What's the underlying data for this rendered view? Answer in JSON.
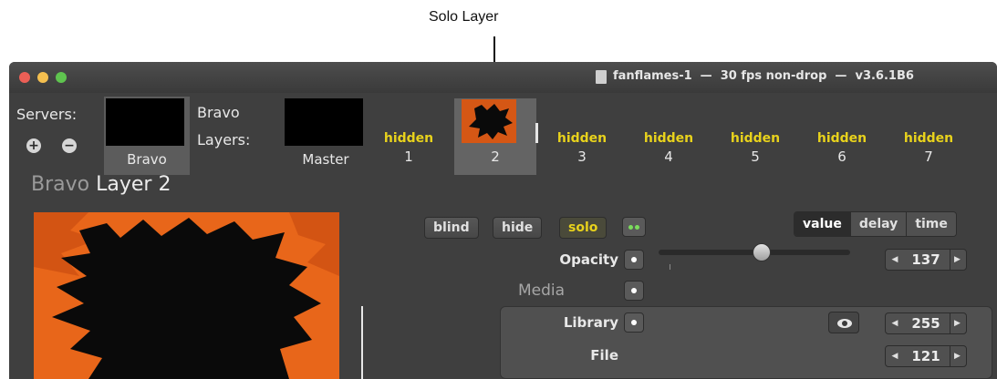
{
  "callout": {
    "label": "Solo Layer"
  },
  "window": {
    "title": "fanflames-1  —  30 fps non-drop  —  v3.6.1B6"
  },
  "servers": {
    "label": "Servers:",
    "add_icon": "plus-circle-icon",
    "remove_icon": "minus-circle-icon",
    "selected": "Bravo"
  },
  "layers_header": {
    "server_name": "Bravo",
    "label": "Layers:",
    "master": "Master"
  },
  "layers": [
    {
      "status": "hidden",
      "number": "1"
    },
    {
      "status": "",
      "number": "2"
    },
    {
      "status": "hidden",
      "number": "3"
    },
    {
      "status": "hidden",
      "number": "4"
    },
    {
      "status": "hidden",
      "number": "5"
    },
    {
      "status": "hidden",
      "number": "6"
    },
    {
      "status": "hidden",
      "number": "7"
    }
  ],
  "panel": {
    "server": "Bravo",
    "layer": "Layer 2"
  },
  "controls": {
    "blind": "blind",
    "hide": "hide",
    "solo": "solo"
  },
  "segments": [
    "value",
    "delay",
    "time"
  ],
  "opacity": {
    "label": "Opacity",
    "value": "137",
    "level": 0.54
  },
  "media": {
    "label": "Media",
    "library_label": "Library",
    "library_value": "255",
    "file_label": "File",
    "file_value": "121"
  },
  "colors": {
    "accent_yellow": "#e8d21c",
    "flame_orange": "#e8661a",
    "indicator_green": "#7bdc5c"
  }
}
